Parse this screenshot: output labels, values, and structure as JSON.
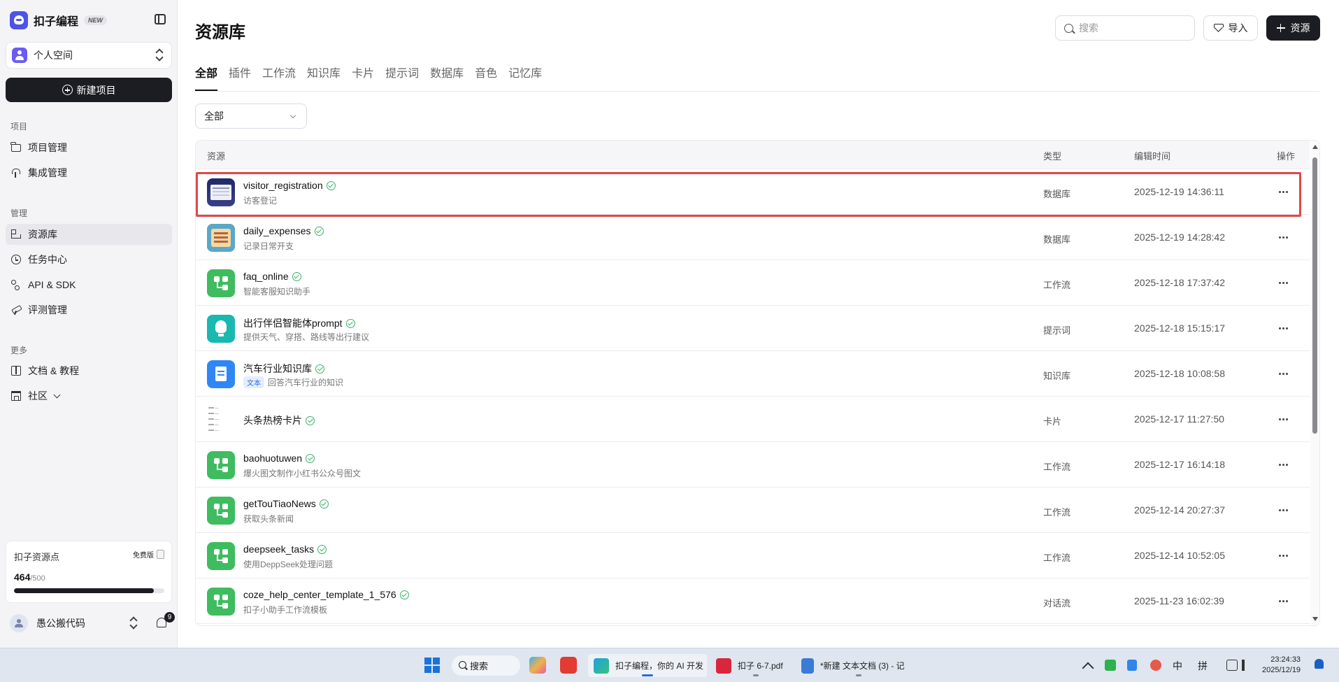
{
  "brand": {
    "name": "扣子编程",
    "badge": "NEW"
  },
  "space": {
    "label": "个人空间"
  },
  "sidebar": {
    "new_project": "新建项目",
    "sections": {
      "project": "项目",
      "manage": "管理",
      "more": "更多"
    },
    "items": [
      {
        "label": "项目管理",
        "icon": "folder-icon"
      },
      {
        "label": "集成管理",
        "icon": "plug-icon"
      },
      {
        "label": "资源库",
        "icon": "grid-icon",
        "active": true
      },
      {
        "label": "任务中心",
        "icon": "clock-icon"
      },
      {
        "label": "API & SDK",
        "icon": "api-icon"
      },
      {
        "label": "评测管理",
        "icon": "telescope-icon"
      },
      {
        "label": "文档 & 教程",
        "icon": "book-icon"
      },
      {
        "label": "社区",
        "icon": "store-icon"
      }
    ],
    "credits": {
      "title": "扣子资源点",
      "plan": "免费版",
      "used": "464",
      "max": "/500",
      "fraction": 0.928
    },
    "user": {
      "name": "愚公搬代码",
      "notifications": "9"
    }
  },
  "main": {
    "title": "资源库",
    "search_placeholder": "搜索",
    "import_label": "导入",
    "add_label": "资源",
    "tabs": [
      "全部",
      "插件",
      "工作流",
      "知识库",
      "卡片",
      "提示词",
      "数据库",
      "音色",
      "记忆库"
    ],
    "filter_value": "全部",
    "columns": {
      "resource": "资源",
      "type": "类型",
      "time": "编辑时间",
      "actions": "操作"
    },
    "rows": [
      {
        "name": "visitor_registration",
        "desc": "访客登记",
        "type": "数据库",
        "time": "2025-12-19 14:36:11",
        "icon": "database-icon"
      },
      {
        "name": "daily_expenses",
        "desc": "记录日常开支",
        "type": "数据库",
        "time": "2025-12-19 14:28:42",
        "icon": "database-icon"
      },
      {
        "name": "faq_online",
        "desc": "智能客服知识助手",
        "type": "工作流",
        "time": "2025-12-18 17:37:42",
        "icon": "workflow-icon"
      },
      {
        "name": "出行伴侣智能体prompt",
        "desc": "提供天气、穿搭、路线等出行建议",
        "type": "提示词",
        "time": "2025-12-18 15:15:17",
        "icon": "prompt-icon"
      },
      {
        "name": "汽车行业知识库",
        "tag": "文本",
        "desc": "回答汽车行业的知识",
        "type": "知识库",
        "time": "2025-12-18 10:08:58",
        "icon": "knowledge-icon"
      },
      {
        "name": "头条热榜卡片",
        "desc": "",
        "type": "卡片",
        "time": "2025-12-17 11:27:50",
        "icon": "card-icon"
      },
      {
        "name": "baohuotuwen",
        "desc": "爆火图文制作小红书公众号图文",
        "type": "工作流",
        "time": "2025-12-17 16:14:18",
        "icon": "workflow-icon"
      },
      {
        "name": "getTouTiaoNews",
        "desc": "获取头条新闻",
        "type": "工作流",
        "time": "2025-12-14 20:27:37",
        "icon": "workflow-icon"
      },
      {
        "name": "deepseek_tasks",
        "desc": "使用DeppSeek处理问题",
        "type": "工作流",
        "time": "2025-12-14 10:52:05",
        "icon": "workflow-icon"
      },
      {
        "name": "coze_help_center_template_1_576",
        "desc": "扣子小助手工作流模板",
        "type": "对话流",
        "time": "2025-11-23 16:02:39",
        "icon": "workflow-icon"
      }
    ]
  },
  "taskbar": {
    "search": "搜索",
    "tasks": [
      {
        "label": "扣子编程，你的 AI 开发",
        "icon": "edge-icon"
      },
      {
        "label": "扣子 6-7.pdf",
        "icon": "pdf-icon"
      },
      {
        "label": "*新建 文本文档 (3) - 记",
        "icon": "notepad-icon"
      }
    ],
    "tray": {
      "ime_zh": "中",
      "ime_pinyin": "拼"
    },
    "clock": {
      "time": "23:24:33",
      "date": "2025/12/19"
    }
  },
  "colors": {
    "accent": "#4d53e8",
    "dark_button": "#1c1c23",
    "highlight_border": "#e04848",
    "check_green": "#3ab26a",
    "workflow_green": "#3fbc5f"
  }
}
